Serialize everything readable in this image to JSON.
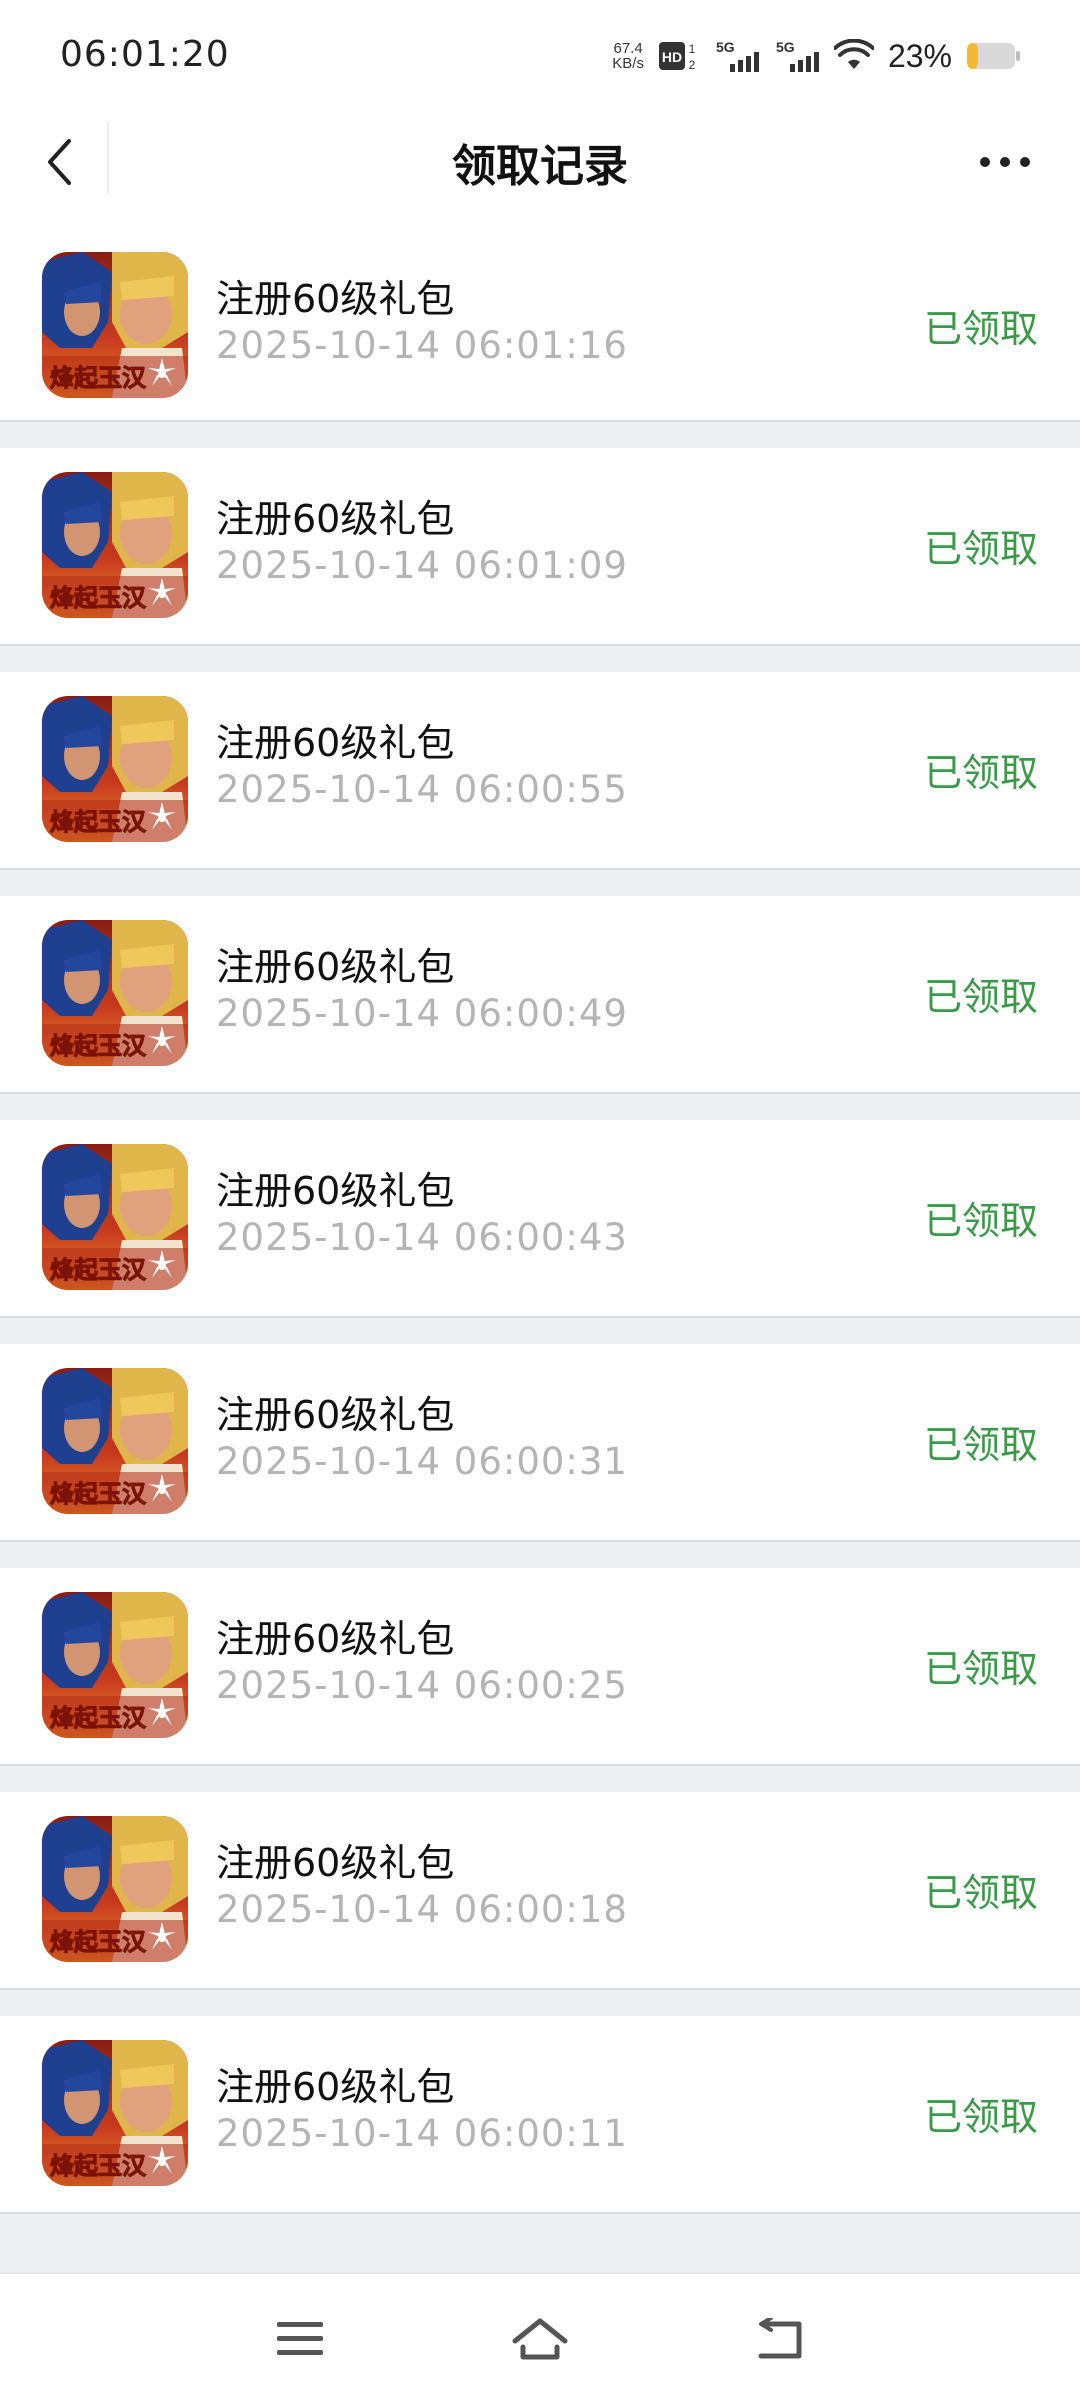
{
  "status_bar": {
    "time": "06:01:20",
    "net_speed_value": "67.4",
    "net_speed_unit": "KB/s",
    "hd_label": "HD",
    "sim1_label": "5G",
    "sim2_label": "5G",
    "battery": "23%",
    "battery_level": 0.23,
    "battery_color": "#f5b82e"
  },
  "header": {
    "title": "领取记录"
  },
  "records": [
    {
      "title": "注册60级礼包",
      "time": "2025-10-14 06:01:16",
      "status": "已领取"
    },
    {
      "title": "注册60级礼包",
      "time": "2025-10-14 06:01:09",
      "status": "已领取"
    },
    {
      "title": "注册60级礼包",
      "time": "2025-10-14 06:00:55",
      "status": "已领取"
    },
    {
      "title": "注册60级礼包",
      "time": "2025-10-14 06:00:49",
      "status": "已领取"
    },
    {
      "title": "注册60级礼包",
      "time": "2025-10-14 06:00:43",
      "status": "已领取"
    },
    {
      "title": "注册60级礼包",
      "time": "2025-10-14 06:00:31",
      "status": "已领取"
    },
    {
      "title": "注册60级礼包",
      "time": "2025-10-14 06:00:25",
      "status": "已领取"
    },
    {
      "title": "注册60级礼包",
      "time": "2025-10-14 06:00:18",
      "status": "已领取"
    },
    {
      "title": "注册60级礼包",
      "time": "2025-10-14 06:00:11",
      "status": "已领取"
    }
  ],
  "game_icon": {
    "logo_text": "烽起玉汉",
    "icon_name": "game-app-icon"
  },
  "colors": {
    "status_green": "#3a9a45",
    "time_gray": "#b4b4b4",
    "background": "#eeeff2"
  },
  "nav_bar": {
    "icons": [
      "menu-icon",
      "home-icon",
      "back-icon"
    ]
  }
}
